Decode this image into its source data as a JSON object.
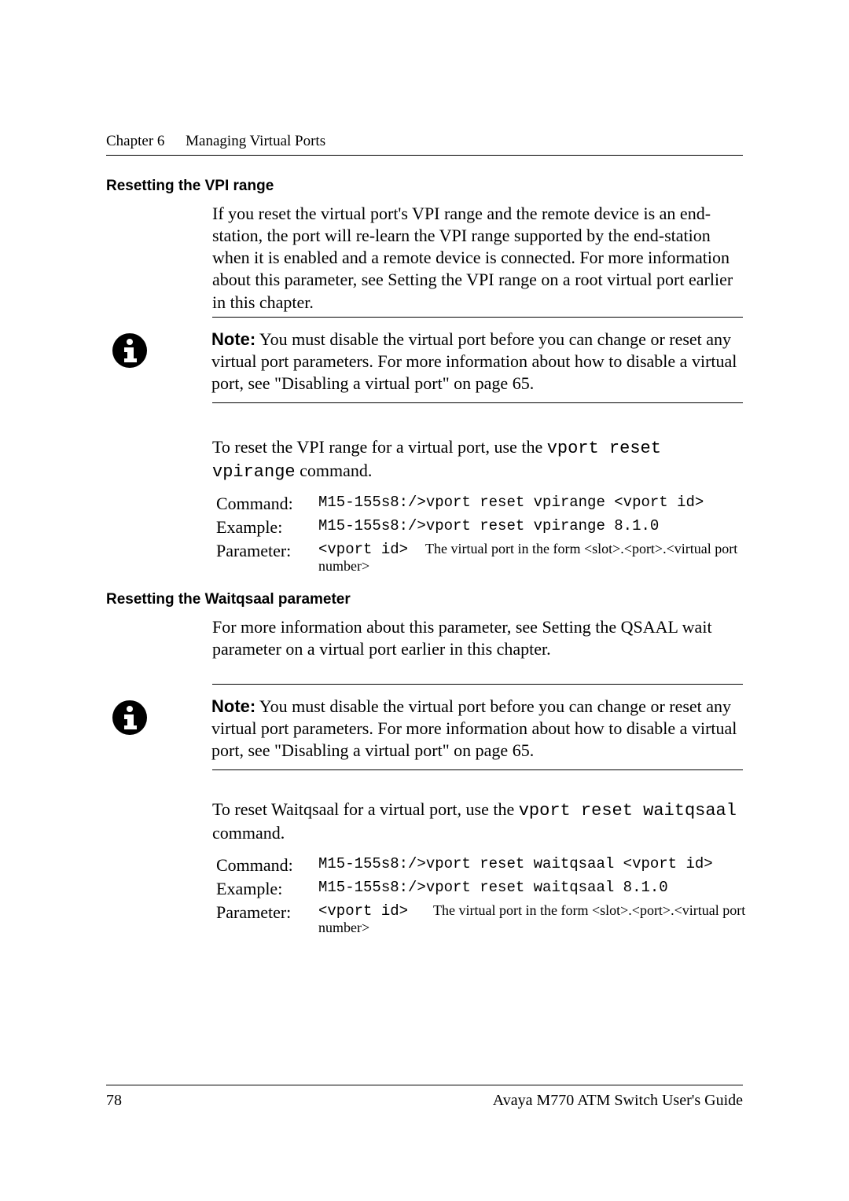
{
  "header": {
    "chapter_label": "Chapter 6",
    "chapter_title": "Managing Virtual Ports"
  },
  "section_vpi": {
    "heading": "Resetting the VPI range",
    "paragraph": "If you reset the virtual port's VPI range and the remote device is an end-station, the port will re-learn the VPI range supported by the end-station when it is enabled and a remote device is connected. For more information about this parameter, see Setting the VPI range on a root virtual port earlier in this chapter.",
    "note_label": "Note:",
    "note_text": "  You must disable the virtual port before you can change or reset any virtual port parameters. For more information about how to disable a virtual port, see \"Disabling a virtual port\" on page 65.",
    "lead_in_pre": "To reset the VPI range for a virtual port, use the ",
    "lead_in_cmd": "vport reset vpirange",
    "lead_in_post": " command.",
    "rows": {
      "command_lbl": "Command:",
      "command_val": "M15-155s8:/>vport reset vpirange <vport id>",
      "example_lbl": "Example:",
      "example_val": "M15-155s8:/>vport reset vpirange 8.1.0",
      "parameter_lbl": "Parameter:",
      "parameter_code": "<vport id>",
      "parameter_desc": "The virtual port in the form <slot>.<port>.<virtual port number>"
    }
  },
  "section_waitqsaal": {
    "heading": "Resetting the Waitqsaal parameter",
    "paragraph": "For more information about this parameter, see Setting the QSAAL wait parameter on a virtual port earlier in this chapter.",
    "note_label": "Note:",
    "note_text": "  You must disable the virtual port before you can change or reset any virtual port parameters. For more information about how to disable a virtual port, see \"Disabling a virtual port\" on page 65.",
    "lead_in_pre": "To reset Waitqsaal for a virtual port, use the ",
    "lead_in_cmd": "vport reset waitqsaal",
    "lead_in_post": " command.",
    "rows": {
      "command_lbl": "Command:",
      "command_val": "M15-155s8:/>vport reset waitqsaal <vport id>",
      "example_lbl": "Example:",
      "example_val": "M15-155s8:/>vport reset waitqsaal 8.1.0",
      "parameter_lbl": "Parameter:",
      "parameter_code": "<vport id>",
      "parameter_desc": "The virtual port in the form <slot>.<port>.<virtual port number>"
    }
  },
  "footer": {
    "page_number": "78",
    "doc_title": "Avaya M770 ATM Switch User's Guide"
  },
  "icons": {
    "info": "info-icon"
  }
}
